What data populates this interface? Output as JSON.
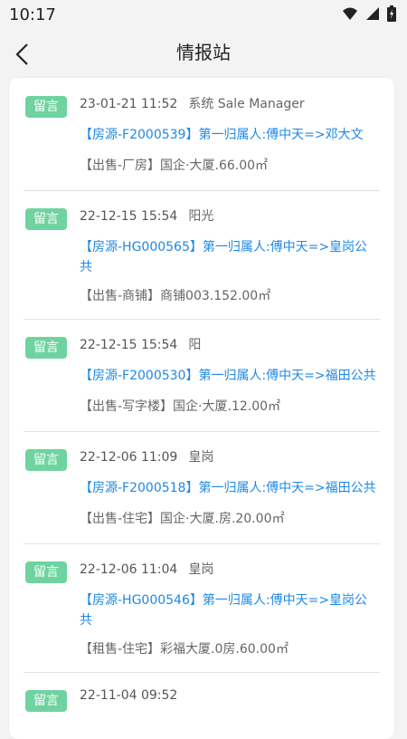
{
  "status": {
    "time": "10:17"
  },
  "header": {
    "title": "情报站"
  },
  "items": [
    {
      "badge": "留言",
      "datetime": "23-01-21 11:52",
      "sender": "系统 Sale Manager",
      "title": "【房源-F2000539】第一归属人:傅中天=>邓大文",
      "desc": "【出售-厂房】国企·大厦.66.00㎡"
    },
    {
      "badge": "留言",
      "datetime": "22-12-15 15:54",
      "sender": "阳光",
      "title": "【房源-HG000565】第一归属人:傅中天=>皇岗公共",
      "desc": "【出售-商铺】商铺003.152.00㎡"
    },
    {
      "badge": "留言",
      "datetime": "22-12-15 15:54",
      "sender": "阳",
      "title": "【房源-F2000530】第一归属人:傅中天=>福田公共",
      "desc": "【出售-写字楼】国企·大厦.12.00㎡"
    },
    {
      "badge": "留言",
      "datetime": "22-12-06 11:09",
      "sender": "皇岗",
      "title": "【房源-F2000518】第一归属人:傅中天=>福田公共",
      "desc": "【出售-住宅】国企·大厦.房.20.00㎡"
    },
    {
      "badge": "留言",
      "datetime": "22-12-06 11:04",
      "sender": "皇岗",
      "title": "【房源-HG000546】第一归属人:傅中天=>皇岗公共",
      "desc": "【租售-住宅】彩福大厦.0房.60.00㎡"
    },
    {
      "badge": "留言",
      "datetime": "22-11-04 09:52",
      "sender": "",
      "title": "",
      "desc": ""
    }
  ]
}
